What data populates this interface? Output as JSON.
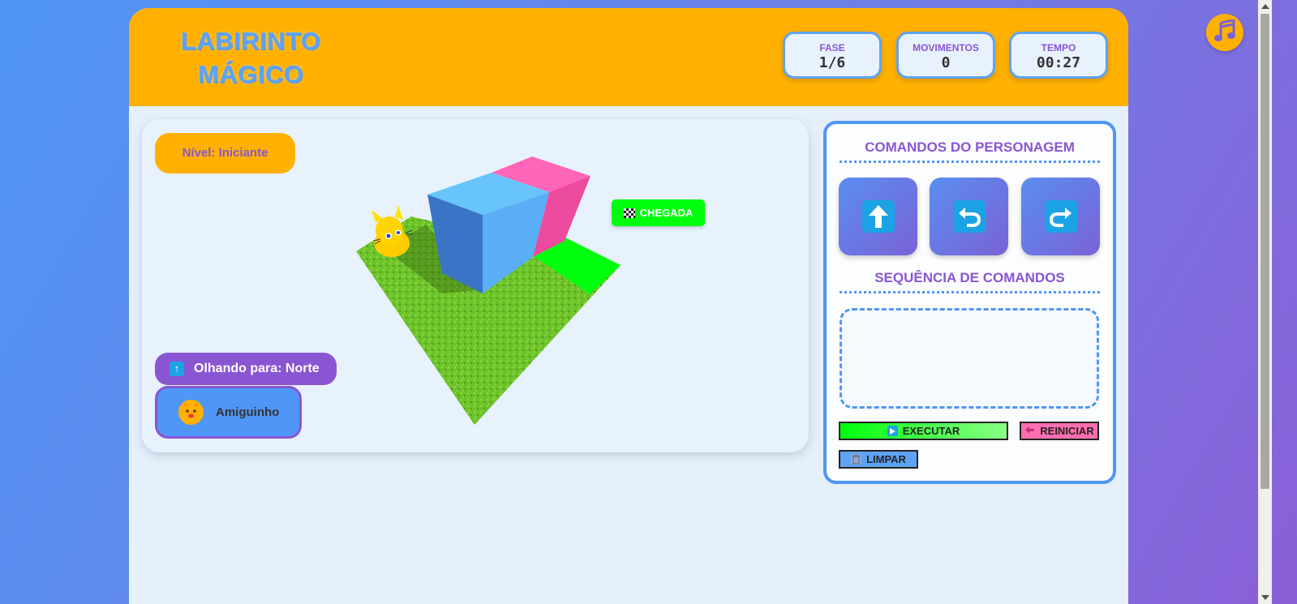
{
  "header": {
    "title_line1": "LABIRINTO",
    "title_line2": "MÁGICO",
    "stats": [
      {
        "label": "FASE",
        "value": "1/6"
      },
      {
        "label": "MOVIMENTOS",
        "value": "0"
      },
      {
        "label": "TEMPO",
        "value": "00:27"
      }
    ]
  },
  "game": {
    "level_label": "Nível: Iniciante",
    "facing_label": "Olhando para: Norte",
    "character_name": "Amiguinho",
    "finish_label": "CHEGADA"
  },
  "panel": {
    "commands_title": "COMANDOS DO PERSONAGEM",
    "commands": [
      {
        "icon": "arrow-up-icon"
      },
      {
        "icon": "turn-left-icon"
      },
      {
        "icon": "turn-right-icon"
      }
    ],
    "sequence_title": "SEQUÊNCIA DE COMANDOS",
    "run_label": "EXECUTAR",
    "reset_label": "REINICIAR",
    "clear_label": "LIMPAR"
  },
  "colors": {
    "orange": "#ffb000",
    "purple": "#8a55d2",
    "blue": "#4f96f7",
    "green": "#00ff0c",
    "pink": "#ff6fb0"
  }
}
